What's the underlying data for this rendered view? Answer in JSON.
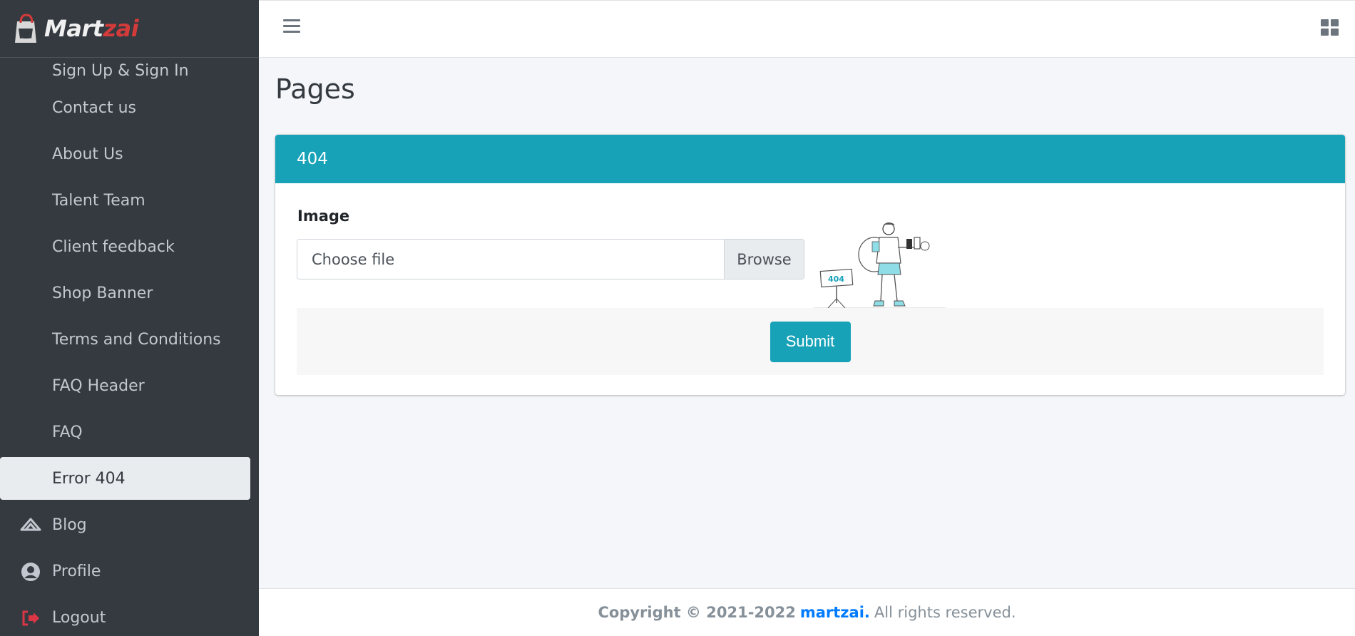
{
  "brand": {
    "part1": "Mart",
    "part2": "zai"
  },
  "sidebar": {
    "items": [
      {
        "label": "Sign Up & Sign In"
      },
      {
        "label": "Contact us"
      },
      {
        "label": "About Us"
      },
      {
        "label": "Talent Team"
      },
      {
        "label": "Client feedback"
      },
      {
        "label": "Shop Banner"
      },
      {
        "label": "Terms and Conditions"
      },
      {
        "label": "FAQ Header"
      },
      {
        "label": "FAQ"
      },
      {
        "label": "Error 404",
        "active": true
      },
      {
        "label": "Blog",
        "icon": "blog-icon"
      },
      {
        "label": "Profile",
        "icon": "user-circle-icon"
      },
      {
        "label": "Logout",
        "icon": "logout-icon"
      }
    ]
  },
  "topbar": {
    "menu_icon": "hamburger-icon",
    "apps_icon": "grid-icon"
  },
  "page": {
    "title": "Pages"
  },
  "card": {
    "header": "404",
    "field_label": "Image",
    "file_placeholder": "Choose file",
    "browse_label": "Browse",
    "submit_label": "Submit",
    "preview_sign_text": "404"
  },
  "footer": {
    "copyright": "Copyright © 2021-2022",
    "brand": "martzai.",
    "rest": "All rights reserved."
  },
  "colors": {
    "sidebar_bg": "#343a40",
    "accent": "#17a2b8",
    "logout_icon": "#dc3545",
    "link": "#007bff"
  }
}
